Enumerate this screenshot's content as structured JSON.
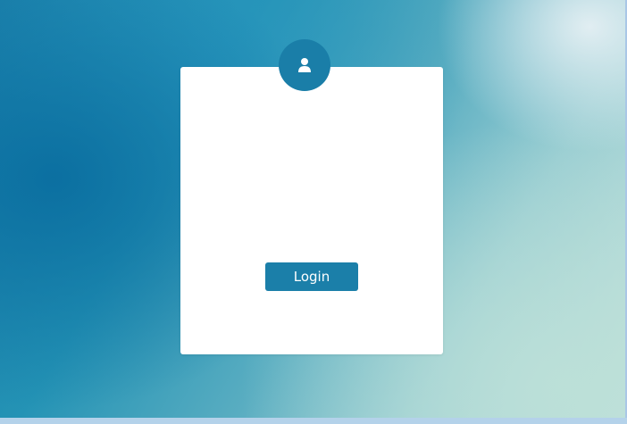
{
  "login": {
    "button_label": "Login",
    "avatar_icon": "user-icon"
  },
  "colors": {
    "accent": "#1b7fa9",
    "card_background": "#ffffff"
  }
}
